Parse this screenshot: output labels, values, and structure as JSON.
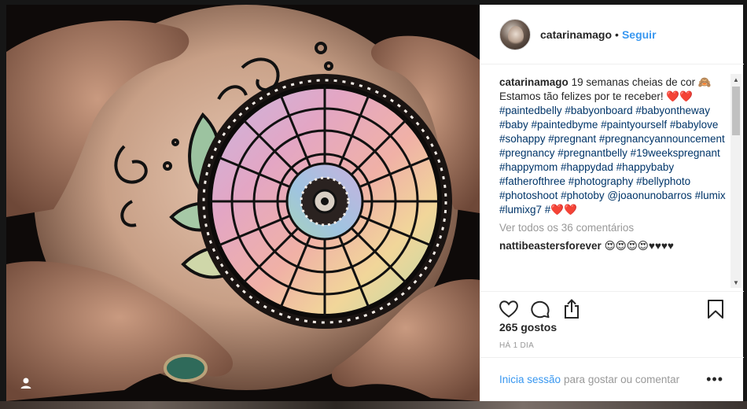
{
  "post": {
    "username": "catarinamago",
    "dot": "•",
    "follow_label": "Seguir"
  },
  "caption": {
    "username": "catarinamago",
    "text": "19 semanas cheias de cor 🙈 Estamos tão felizes por te receber! ❤️❤️",
    "hashtags": "#paintedbelly #babyonboard #babyontheway #baby #paintedbyme #paintyourself #babylove #sohappy #pregnant #pregnancyannouncement #pregnancy #pregnantbelly #19weekspregnant #happymom #happydad #happybaby #fatherofthree #photography #bellyphoto #photoshoot #photoby @joaonunobarros #lumix #lumixg7 #❤️❤️"
  },
  "view_all_comments": "Ver todos os 36 comentários",
  "comment": {
    "username": "nattibeastersforever",
    "text": "😍😍😍😍♥♥♥♥"
  },
  "likes": "265 gostos",
  "time_ago": "HÁ 1 DIA",
  "footer": {
    "login_label": "Inicia sessão",
    "rest": "para gostar ou comentar",
    "more": "•••"
  },
  "icons": {
    "like": "heart-icon",
    "comment": "comment-bubble-icon",
    "share": "share-icon",
    "save": "bookmark-icon",
    "user_tag": "user-icon"
  },
  "colors": {
    "link_blue": "#3897f0",
    "hashtag_blue": "#003569",
    "text": "#262626",
    "muted": "#999999"
  }
}
